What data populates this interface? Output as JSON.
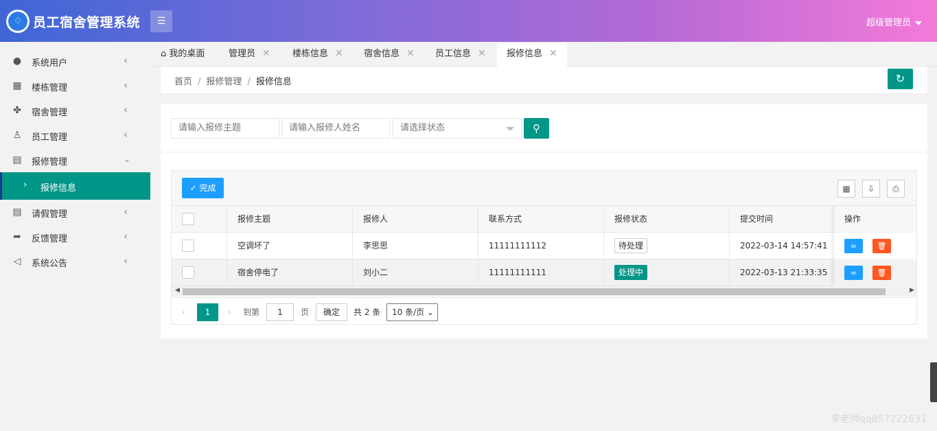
{
  "header": {
    "app_title": "员工宿舍管理系统",
    "user_label": "超级管理员",
    "brand_gradient": [
      "#3f66d6",
      "#f47ad9"
    ]
  },
  "sidebar": {
    "items": [
      {
        "label": "系统用户",
        "icon": "user-icon"
      },
      {
        "label": "楼栋管理",
        "icon": "grid-icon"
      },
      {
        "label": "宿舍管理",
        "icon": "cluster-icon"
      },
      {
        "label": "员工管理",
        "icon": "person-outline-icon"
      },
      {
        "label": "报修管理",
        "icon": "doc-icon"
      },
      {
        "label": "请假管理",
        "icon": "doc-icon"
      },
      {
        "label": "反馈管理",
        "icon": "share-icon"
      },
      {
        "label": "系统公告",
        "icon": "speaker-icon"
      }
    ],
    "active_sub": "报修信息",
    "accent_color": "#009688"
  },
  "tabs": [
    {
      "label": "我的桌面"
    },
    {
      "label": "管理员"
    },
    {
      "label": "楼栋信息"
    },
    {
      "label": "宿舍信息"
    },
    {
      "label": "员工信息"
    },
    {
      "label": "报修信息"
    }
  ],
  "breadcrumb": {
    "home": "首页",
    "parent": "报修管理",
    "current": "报修信息"
  },
  "search": {
    "subject_placeholder": "请输入报修主题",
    "name_placeholder": "请输入报修人姓名",
    "status_placeholder": "请选择状态"
  },
  "toolbar": {
    "done_label": "完成"
  },
  "table": {
    "headers": [
      "报修主题",
      "报修人",
      "联系方式",
      "报修状态",
      "提交时间",
      "操作"
    ],
    "rows": [
      {
        "subject": "空调坏了",
        "reporter": "李思思",
        "phone": "11111111112",
        "status": "待处理",
        "time": "2022-03-14 14:57:41"
      },
      {
        "subject": "宿舍停电了",
        "reporter": "刘小二",
        "phone": "11111111111",
        "status": "处理中",
        "time": "2022-03-13 21:33:35"
      }
    ]
  },
  "pager": {
    "current_page": "1",
    "goto_label": "到第",
    "goto_value": "1",
    "page_unit": "页",
    "confirm_label": "确定",
    "total_label": "共 2 条",
    "page_size": "10 条/页"
  },
  "watermark": "李老师qq857222631"
}
